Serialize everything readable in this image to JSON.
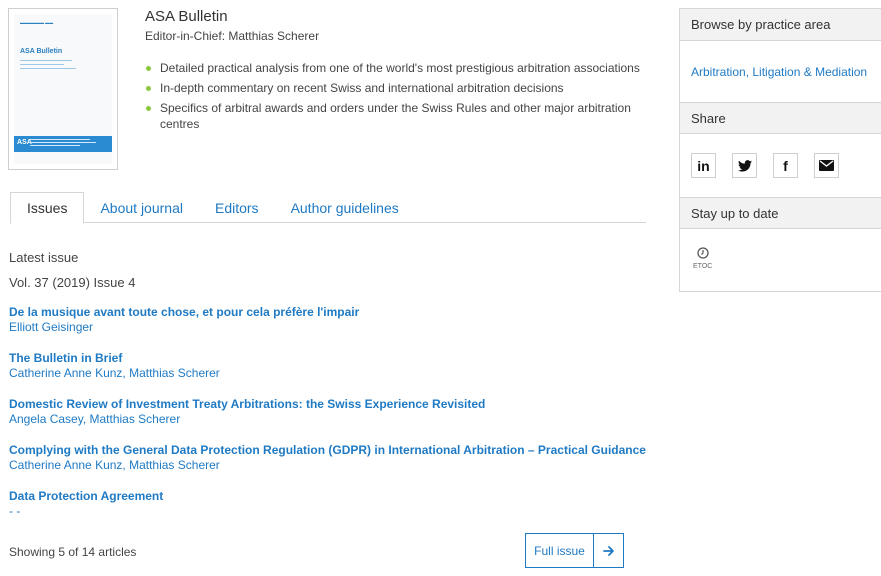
{
  "cover": {
    "title": "ASA Bulletin",
    "logo": "ASA"
  },
  "journal": {
    "title": "ASA Bulletin",
    "editor": "Editor-in-Chief: Matthias Scherer",
    "bullets": [
      "Detailed practical analysis from one of the world's most prestigious arbitration associations",
      "In-depth commentary on recent Swiss and international arbitration decisions",
      "Specifics of arbitral awards and orders under the Swiss Rules and other major arbitration centres"
    ],
    "bullet_color": "#8cc63f"
  },
  "tabs": [
    {
      "label": "Issues",
      "active": true
    },
    {
      "label": "About journal",
      "active": false
    },
    {
      "label": "Editors",
      "active": false
    },
    {
      "label": "Author guidelines",
      "active": false
    }
  ],
  "latest": {
    "label": "Latest issue",
    "issue": "Vol. 37 (2019) Issue 4",
    "articles": [
      {
        "title": "De la musique avant toute chose, et pour cela préfère l'impair",
        "authors": "Elliott Geisinger"
      },
      {
        "title": "The Bulletin in Brief",
        "authors": "Catherine Anne Kunz, Matthias Scherer"
      },
      {
        "title": "Domestic Review of Investment Treaty Arbitrations: the Swiss Experience Revisited",
        "authors": "Angela Casey, Matthias Scherer"
      },
      {
        "title": "Complying with the General Data Protection Regulation (GDPR) in International Arbitration – Practical Guidance",
        "authors": "Catherine Anne Kunz, Matthias Scherer"
      },
      {
        "title": "Data Protection Agreement",
        "authors": "- -"
      }
    ],
    "showing": "Showing 5 of 14 articles",
    "full_issue_label": "Full issue",
    "full_issue_icon": "arrow-right-icon"
  },
  "sidebar": {
    "browse_heading": "Browse by practice area",
    "practice_area": "Arbitration, Litigation & Mediation",
    "share_heading": "Share",
    "share_buttons": [
      {
        "icon": "linkedin-icon",
        "glyph": "in"
      },
      {
        "icon": "twitter-icon",
        "glyph": "🐦"
      },
      {
        "icon": "facebook-icon",
        "glyph": "f"
      },
      {
        "icon": "email-icon",
        "glyph": "✉"
      }
    ],
    "stay_heading": "Stay up to date",
    "etoc_label": "ETOC",
    "etoc_icon": "clock-icon"
  },
  "colors": {
    "link": "#1f7ac4",
    "text": "#333333",
    "header_bg": "#f2f2f2",
    "border": "#d6d6d6",
    "cover_band": "#2a8ad2"
  }
}
